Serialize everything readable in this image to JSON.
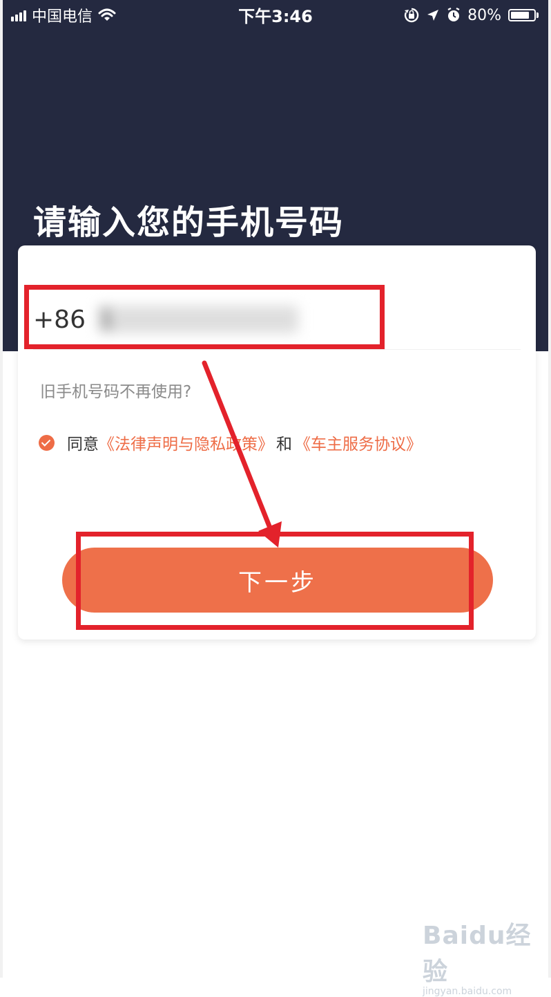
{
  "status_bar": {
    "carrier": "中国电信",
    "time": "下午3:46",
    "battery": "80%",
    "battery_level": 0.8,
    "icons": [
      "signal-icon",
      "wifi-icon",
      "orientation-lock-icon",
      "location-icon",
      "alarm-icon",
      "battery-icon"
    ]
  },
  "page": {
    "title": "请输入您的手机号码"
  },
  "form": {
    "country_code": "+86",
    "phone_value": "1",
    "old_number_link": "旧手机号码不再使用?",
    "agree_label": "同意",
    "legal_link": "《法律声明与隐私政策》",
    "and_text": "和",
    "service_link": "《车主服务协议》",
    "agreement_checked": true,
    "next_button": "下一步"
  },
  "watermark": {
    "logo": "Baidu经验",
    "url": "jingyan.baidu.com"
  },
  "colors": {
    "header_bg": "#242940",
    "accent": "#ee6c46",
    "annotation": "#e3222b"
  }
}
